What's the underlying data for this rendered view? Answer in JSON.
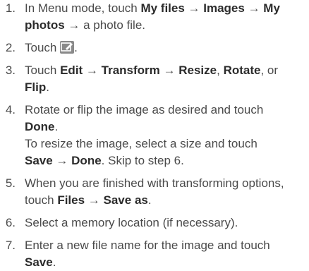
{
  "steps": [
    {
      "number": "1.",
      "line1": [
        {
          "t": "In Menu mode, touch ",
          "s": "n"
        },
        {
          "t": "My files",
          "s": "b"
        },
        {
          "t": " → ",
          "s": "a"
        },
        {
          "t": "Images",
          "s": "b"
        },
        {
          "t": " → ",
          "s": "a"
        },
        {
          "t": "My",
          "s": "b"
        }
      ],
      "line2": [
        {
          "t": "photos",
          "s": "b"
        },
        {
          "t": " → a photo file.",
          "s": "n"
        }
      ]
    },
    {
      "number": "2.",
      "line1": [
        {
          "t": "Touch ",
          "s": "n"
        },
        {
          "t": "edit-icon",
          "s": "icon"
        },
        {
          "t": ".",
          "s": "n"
        }
      ]
    },
    {
      "number": "3.",
      "line1": [
        {
          "t": "Touch ",
          "s": "n"
        },
        {
          "t": "Edit",
          "s": "b"
        },
        {
          "t": " → ",
          "s": "a"
        },
        {
          "t": "Transform",
          "s": "b"
        },
        {
          "t": " → ",
          "s": "a"
        },
        {
          "t": "Resize",
          "s": "b"
        },
        {
          "t": ", ",
          "s": "n"
        },
        {
          "t": "Rotate",
          "s": "b"
        },
        {
          "t": ", or",
          "s": "n"
        }
      ],
      "line2": [
        {
          "t": "Flip",
          "s": "b"
        },
        {
          "t": ".",
          "s": "n"
        }
      ]
    },
    {
      "number": "4.",
      "line1": [
        {
          "t": "Rotate or flip the image as desired and touch",
          "s": "n"
        }
      ],
      "line2": [
        {
          "t": "Done",
          "s": "b"
        },
        {
          "t": ".",
          "s": "n"
        }
      ],
      "line3": [
        {
          "t": "To resize the image, select a size and touch",
          "s": "n"
        }
      ],
      "line4": [
        {
          "t": "Save",
          "s": "b"
        },
        {
          "t": " → ",
          "s": "a"
        },
        {
          "t": "Done",
          "s": "b"
        },
        {
          "t": ". Skip to step 6.",
          "s": "n"
        }
      ]
    },
    {
      "number": "5.",
      "line1": [
        {
          "t": "When you are finished with transforming options,",
          "s": "n"
        }
      ],
      "line2": [
        {
          "t": "touch ",
          "s": "n"
        },
        {
          "t": "Files",
          "s": "b"
        },
        {
          "t": " → ",
          "s": "a"
        },
        {
          "t": "Save as",
          "s": "b"
        },
        {
          "t": ".",
          "s": "n"
        }
      ]
    },
    {
      "number": "6.",
      "line1": [
        {
          "t": "Select a memory location (if necessary).",
          "s": "n"
        }
      ]
    },
    {
      "number": "7.",
      "line1": [
        {
          "t": "Enter a new file name for the image and touch",
          "s": "n"
        }
      ],
      "line2": [
        {
          "t": "Save",
          "s": "b"
        },
        {
          "t": ".",
          "s": "n"
        }
      ]
    }
  ]
}
